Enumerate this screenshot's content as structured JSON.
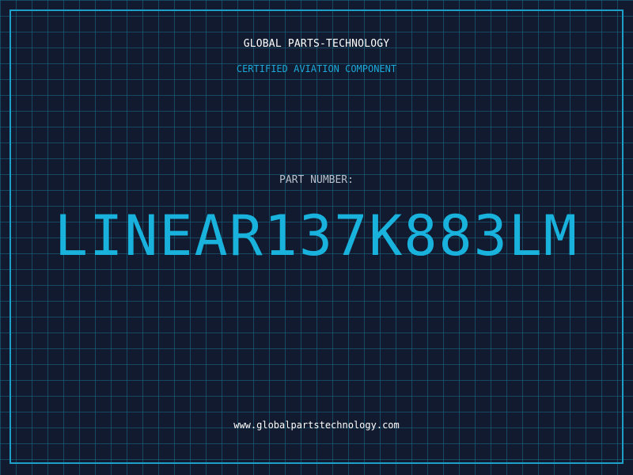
{
  "header": {
    "company": "GLOBAL PARTS-TECHNOLOGY",
    "subtitle": "CERTIFIED AVIATION COMPONENT"
  },
  "part": {
    "label": "PART NUMBER:",
    "number": "LINEAR137K883LM"
  },
  "footer": {
    "website": "www.globalpartstechnology.com"
  },
  "colors": {
    "background": "#111a2e",
    "grid": "#1a6e8c",
    "accent": "#1ca8d8",
    "frame": "#1e9fc7",
    "text": "#ffffff",
    "label": "#b8c0cc"
  }
}
